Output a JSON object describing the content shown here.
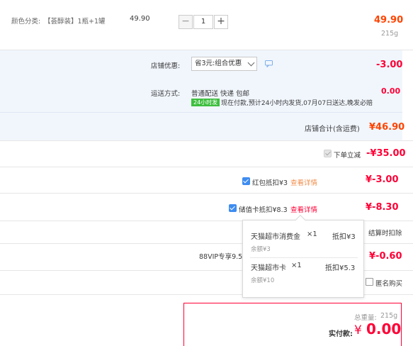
{
  "item": {
    "spec_label": "颜色分类:",
    "spec_value": "【荟醇装】1瓶+1罐",
    "unit_price": "49.90",
    "quantity": "1",
    "minus_glyph": "−",
    "plus_glyph": "+",
    "subtotal": "49.90",
    "weight": "215g"
  },
  "shop": {
    "discount_label": "店铺优惠:",
    "discount_option": "省3元:组合优惠",
    "discount_amount": "-3.00",
    "shipping_label": "运送方式:",
    "shipping_text": "普通配送 快递 包邮",
    "shipping_fee": "0.00",
    "delivery_tag": "24小时发",
    "delivery_note": "现在付款,预计24小时内发货,07月07日送达,晚发必赔",
    "total_label": "店铺合计(含运费)",
    "total_value": "¥46.90"
  },
  "discounts": {
    "instant_label": "下单立减",
    "instant_amount": "-¥35.00",
    "redpacket_label": "红包抵扣¥3",
    "redpacket_link": "查看详情",
    "redpacket_amount": "¥-3.00",
    "storedcard_label": "储值卡抵扣¥8.3",
    "storedcard_link": "查看详情",
    "storedcard_amount": "¥-8.30",
    "settle_note": "结算时扣除",
    "vip_label": "88VIP专享9.5",
    "vip_amount": "¥-0.60",
    "anonymous_label": "匿名购买"
  },
  "popup": {
    "rows": [
      {
        "name": "天猫超市消费金",
        "count": "×1",
        "deduct": "抵扣¥3",
        "balance": "余额¥3"
      },
      {
        "name": "天猫超市卡",
        "count": "×1",
        "deduct": "抵扣¥5.3",
        "balance": "余额¥10"
      }
    ]
  },
  "summary": {
    "weight_label": "总重量:",
    "weight_value": "215g",
    "paid_label": "实付款:",
    "currency": "¥",
    "paid_value": "0.00"
  },
  "colors": {
    "accent_red": "#ff0036",
    "accent_orange": "#f40",
    "band_blue": "#f1f6fd",
    "checkbox_blue": "#3e8cf0",
    "tag_green": "#3fbf3f"
  },
  "icons": [
    "chat-bubble-icon",
    "checkbox-icon",
    "chevron-down-icon"
  ]
}
